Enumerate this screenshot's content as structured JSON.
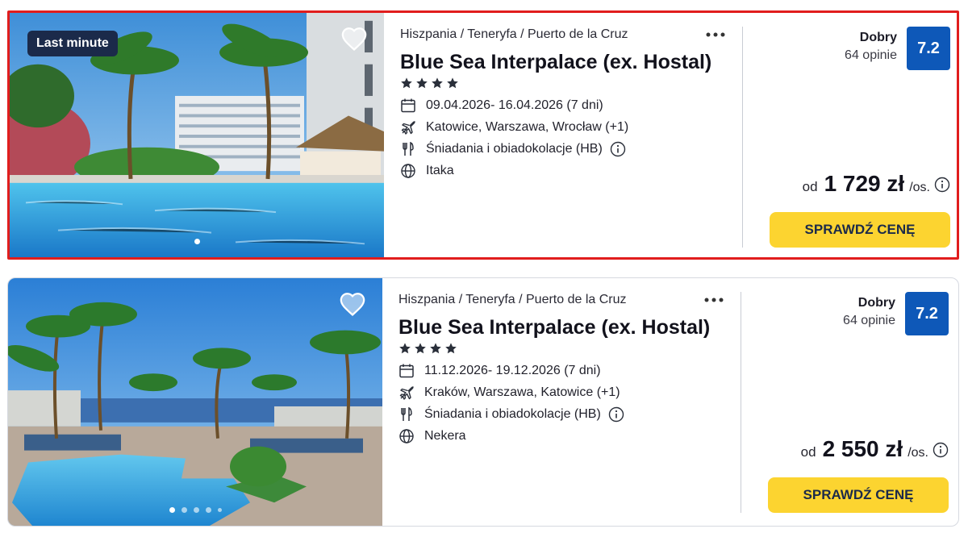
{
  "offers": [
    {
      "badge": "Last minute",
      "breadcrumb": "Hiszpania / Teneryfa / Puerto de la Cruz",
      "name": "Blue Sea Interpalace (ex. Hostal)",
      "stars": 4,
      "dates": "09.04.2026- 16.04.2026  (7 dni)",
      "departure": "Katowice, Warszawa, Wrocław  (+1)",
      "board": "Śniadania i obiadokolacje (HB)",
      "operator": "Itaka",
      "rating_label": "Dobry",
      "rating_count": "64 opinie",
      "rating_score": "7.2",
      "price_prefix": "od",
      "price": "1 729 zł",
      "price_unit": "/os.",
      "cta": "SPRAWDŹ CENĘ",
      "photo_icon": "hotel-pool-photo"
    },
    {
      "badge": "",
      "breadcrumb": "Hiszpania / Teneryfa / Puerto de la Cruz",
      "name": "Blue Sea Interpalace (ex. Hostal)",
      "stars": 4,
      "dates": "11.12.2026- 19.12.2026  (7 dni)",
      "departure": "Kraków, Warszawa, Katowice  (+1)",
      "board": "Śniadania i obiadokolacje (HB)",
      "operator": "Nekera",
      "rating_label": "Dobry",
      "rating_count": "64 opinie",
      "rating_score": "7.2",
      "price_prefix": "od",
      "price": "2 550 zł",
      "price_unit": "/os.",
      "cta": "SPRAWDŹ CENĘ",
      "photo_icon": "hotel-pool-photo"
    }
  ],
  "colors": {
    "highlight_border": "#e11d1d",
    "score_bg": "#0e58b8",
    "cta_bg": "#fcd430",
    "badge_bg": "#1b2a4a"
  }
}
